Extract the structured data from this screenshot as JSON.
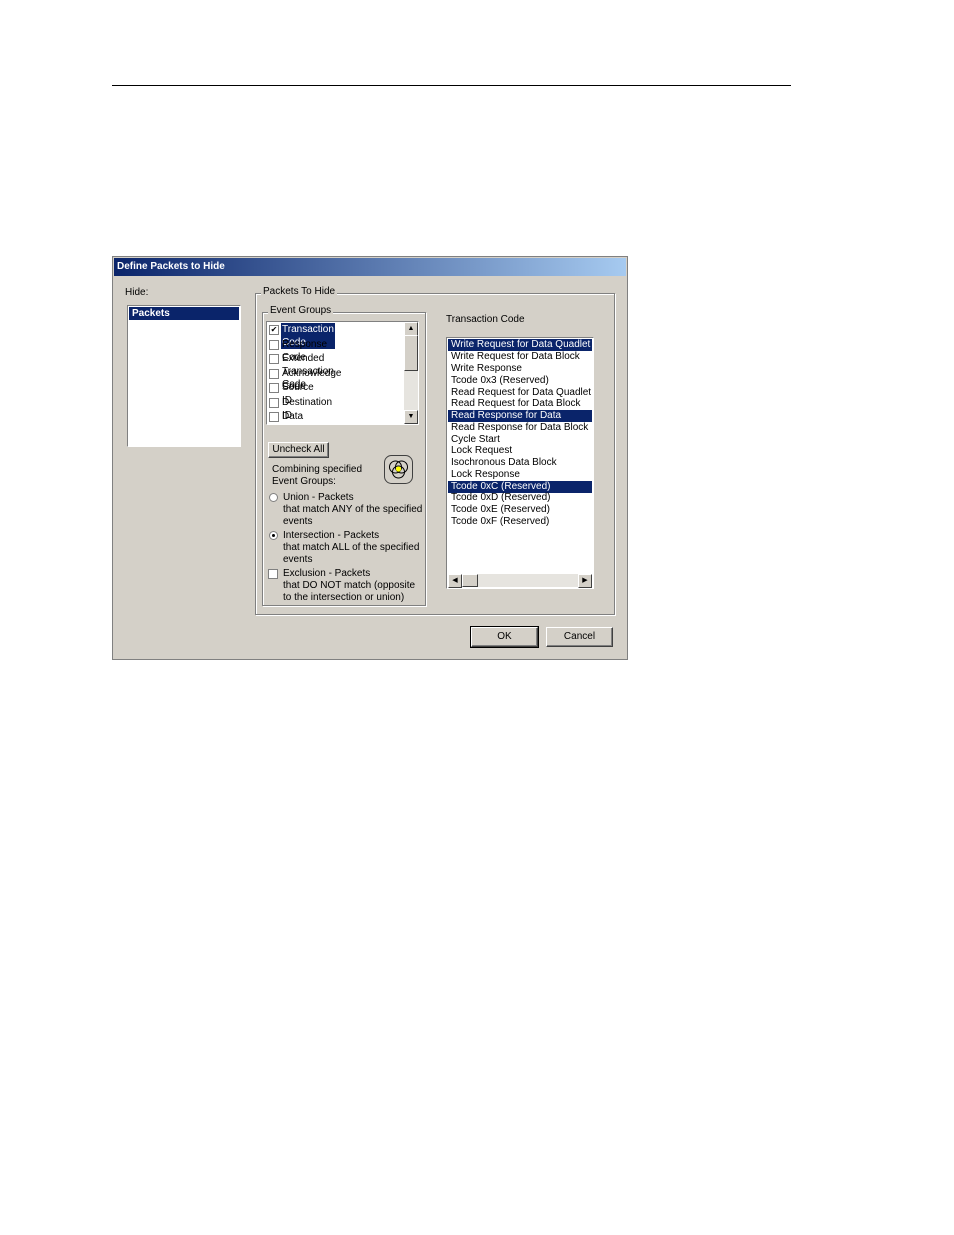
{
  "dialog": {
    "title": "Define Packets to Hide",
    "hide_label": "Hide:",
    "hide_items": [
      "Packets"
    ],
    "packets_group_title": "Packets To Hide",
    "event_groups_title": "Event Groups",
    "event_groups": [
      {
        "label": "Transaction Code",
        "checked": true,
        "selected": true
      },
      {
        "label": "Response Code",
        "checked": false
      },
      {
        "label": "Extended Transaction Code",
        "checked": false
      },
      {
        "label": "Acknowledge Code",
        "checked": false
      },
      {
        "label": "Source ID",
        "checked": false
      },
      {
        "label": "Destination ID",
        "checked": false
      },
      {
        "label": "Data Length",
        "checked": false
      }
    ],
    "uncheck_all_label": "Uncheck All",
    "combining_label_1": "Combining specified",
    "combining_label_2": "Event Groups:",
    "union": {
      "line1": "Union - Packets",
      "line2": "that match ANY of the specified",
      "line3": "events",
      "selected": false
    },
    "intersection": {
      "line1": "Intersection - Packets",
      "line2": "that match ALL of the specified",
      "line3": "events",
      "selected": true
    },
    "exclusion": {
      "line1": "Exclusion - Packets",
      "line2": "that DO NOT match (opposite",
      "line3": "to the intersection or union)",
      "checked": false
    },
    "transaction_code_label": "Transaction Code",
    "transaction_codes": [
      {
        "label": "Write Request for Data Quadlet",
        "selected": true
      },
      {
        "label": "Write Request for Data Block",
        "selected": false
      },
      {
        "label": "Write Response",
        "selected": false
      },
      {
        "label": "Tcode 0x3 (Reserved)",
        "selected": false
      },
      {
        "label": "Read Request for Data Quadlet",
        "selected": false
      },
      {
        "label": "Read Request for Data Block",
        "selected": false
      },
      {
        "label": "Read Response for Data Quadlet",
        "selected": true
      },
      {
        "label": "Read Response for Data Block",
        "selected": false
      },
      {
        "label": "Cycle Start",
        "selected": false
      },
      {
        "label": "Lock Request",
        "selected": false
      },
      {
        "label": "Isochronous Data Block",
        "selected": false
      },
      {
        "label": "Lock Response",
        "selected": false
      },
      {
        "label": "Tcode 0xC (Reserved)",
        "selected": true
      },
      {
        "label": "Tcode 0xD (Reserved)",
        "selected": false
      },
      {
        "label": "Tcode 0xE (Reserved)",
        "selected": false
      },
      {
        "label": "Tcode 0xF (Reserved)",
        "selected": false
      }
    ],
    "ok_label": "OK",
    "cancel_label": "Cancel"
  },
  "colors": {
    "selection": "#0a246a",
    "dialog_bg": "#d4d0c8"
  },
  "icons": {
    "venn": "venn-diagram-icon",
    "check": "✔"
  }
}
